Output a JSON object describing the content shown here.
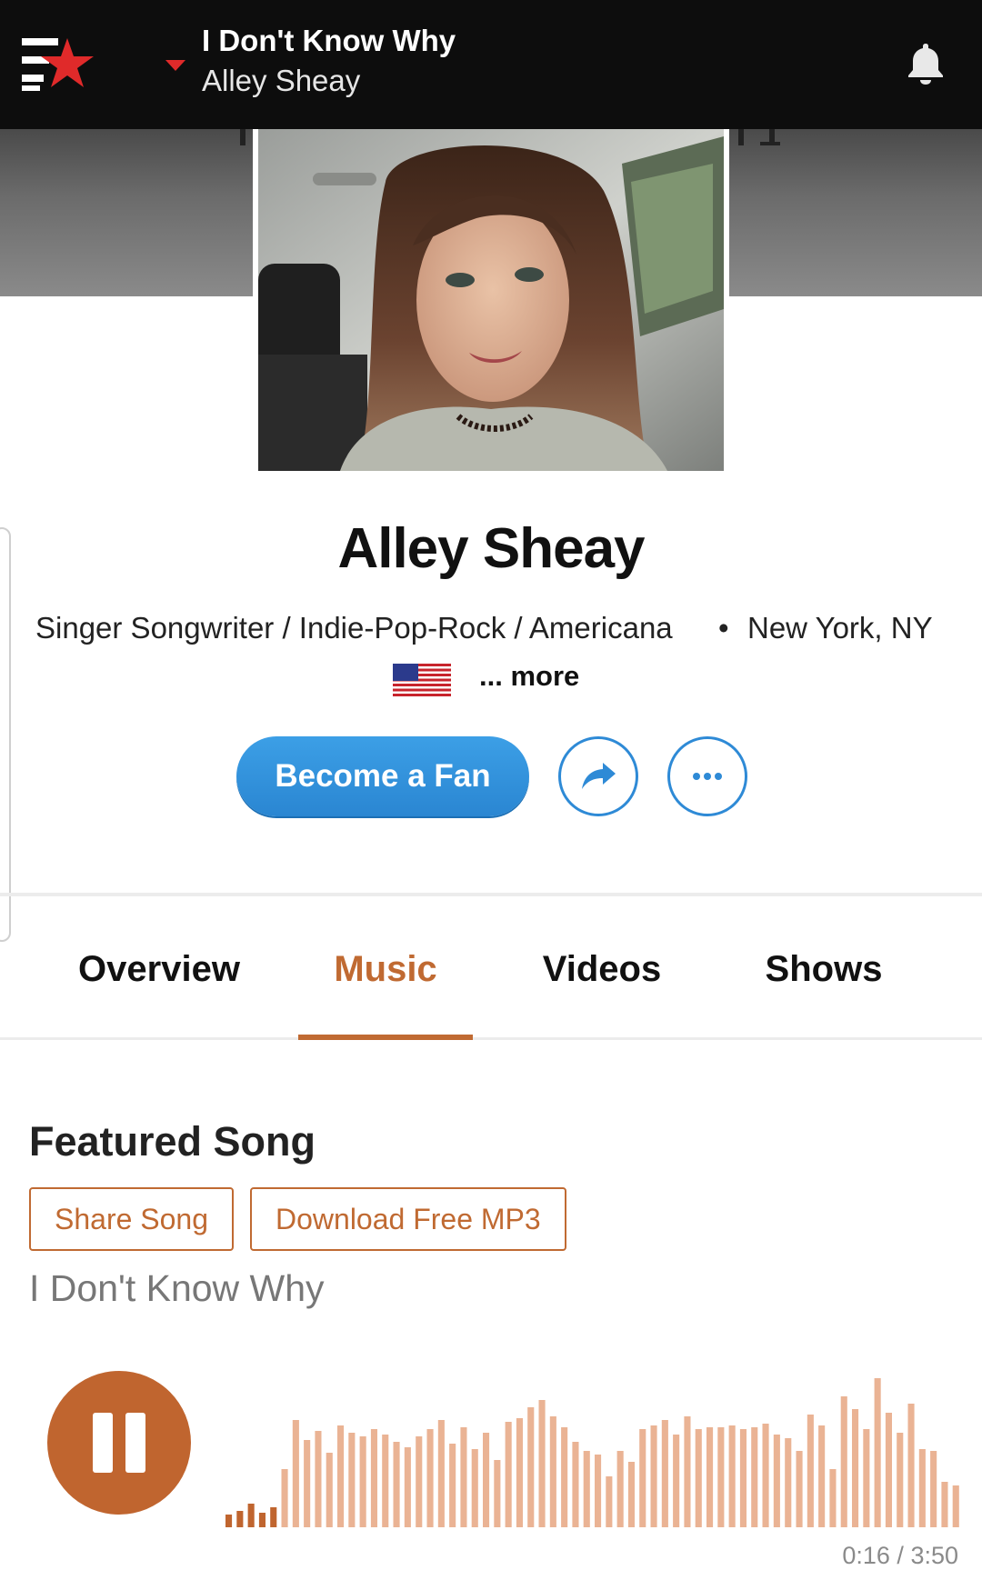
{
  "now_playing": {
    "title": "I Don't Know Why",
    "artist": "Alley Sheay"
  },
  "profile": {
    "name": "Alley Sheay",
    "genre": "Singer Songwriter / Indie-Pop-Rock / Americana",
    "separator": "•",
    "location": "New York, NY",
    "more_label": "... more"
  },
  "actions": {
    "fan_label": "Become a Fan"
  },
  "tabs": [
    {
      "label": "Overview",
      "active": false
    },
    {
      "label": "Music",
      "active": true
    },
    {
      "label": "Videos",
      "active": false
    },
    {
      "label": "Shows",
      "active": false
    }
  ],
  "featured": {
    "heading": "Featured Song",
    "share_label": "Share Song",
    "download_label": "Download Free MP3",
    "song_title": "I Don't Know Why"
  },
  "player": {
    "state": "playing",
    "elapsed": "0:16",
    "total": "3:50",
    "progress": 0.07,
    "time_separator": "/"
  },
  "colors": {
    "accent": "#c06a32",
    "fan_button": "#2f8fdb",
    "topbar": "#0d0d0d",
    "wave_played": "#c0652f",
    "wave_unplayed": "#eab394"
  },
  "icons": {
    "logo": "reverbnation-star-icon",
    "caret": "caret-down-icon",
    "notifications": "bell-icon",
    "share": "share-arrow-icon",
    "more": "more-dots-icon",
    "pause": "pause-icon",
    "flag": "us-flag-icon"
  }
}
